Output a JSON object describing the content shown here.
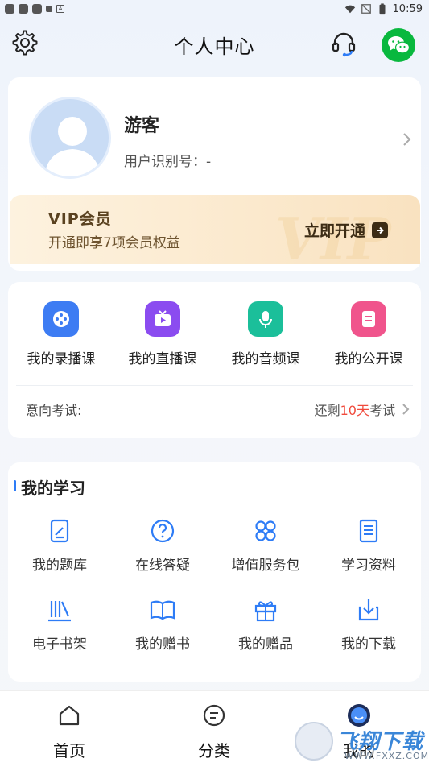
{
  "status_bar": {
    "time": "10:59",
    "badge": "A"
  },
  "header": {
    "title": "个人中心"
  },
  "profile": {
    "name": "游客",
    "user_id_label": "用户识别号：-"
  },
  "vip": {
    "title": "VIP会员",
    "desc": "开通即享7项会员权益",
    "button": "立即开通",
    "watermark": "VIP"
  },
  "courses": {
    "items": [
      {
        "label": "我的录播课",
        "color": "#3d7cf3",
        "icon": "film-reel-icon"
      },
      {
        "label": "我的直播课",
        "color": "#8b4cf0",
        "icon": "tv-play-icon"
      },
      {
        "label": "我的音频课",
        "color": "#1bbf9a",
        "icon": "microphone-icon"
      },
      {
        "label": "我的公开课",
        "color": "#f0548c",
        "icon": "document-icon"
      }
    ],
    "exam_label": "意向考试:",
    "exam_prefix": "还剩",
    "exam_days": "10天",
    "exam_suffix": "考试"
  },
  "study": {
    "title": "我的学习",
    "items": [
      {
        "label": "我的题库",
        "icon": "edit-sheet-icon"
      },
      {
        "label": "在线答疑",
        "icon": "question-icon"
      },
      {
        "label": "增值服务包",
        "icon": "grid-icon"
      },
      {
        "label": "学习资料",
        "icon": "notes-icon"
      },
      {
        "label": "电子书架",
        "icon": "bookshelf-icon"
      },
      {
        "label": "我的赠书",
        "icon": "open-book-icon"
      },
      {
        "label": "我的赠品",
        "icon": "gift-icon"
      },
      {
        "label": "我的下载",
        "icon": "download-icon"
      }
    ]
  },
  "tabbar": {
    "items": [
      {
        "label": "首页",
        "icon": "home-icon"
      },
      {
        "label": "分类",
        "icon": "category-icon"
      },
      {
        "label": "我的",
        "icon": "profile-icon"
      }
    ]
  },
  "watermark": {
    "text": "飞翔下载",
    "url": "WWW.FXXZ.COM"
  },
  "accent_color": "#2e7cf6"
}
